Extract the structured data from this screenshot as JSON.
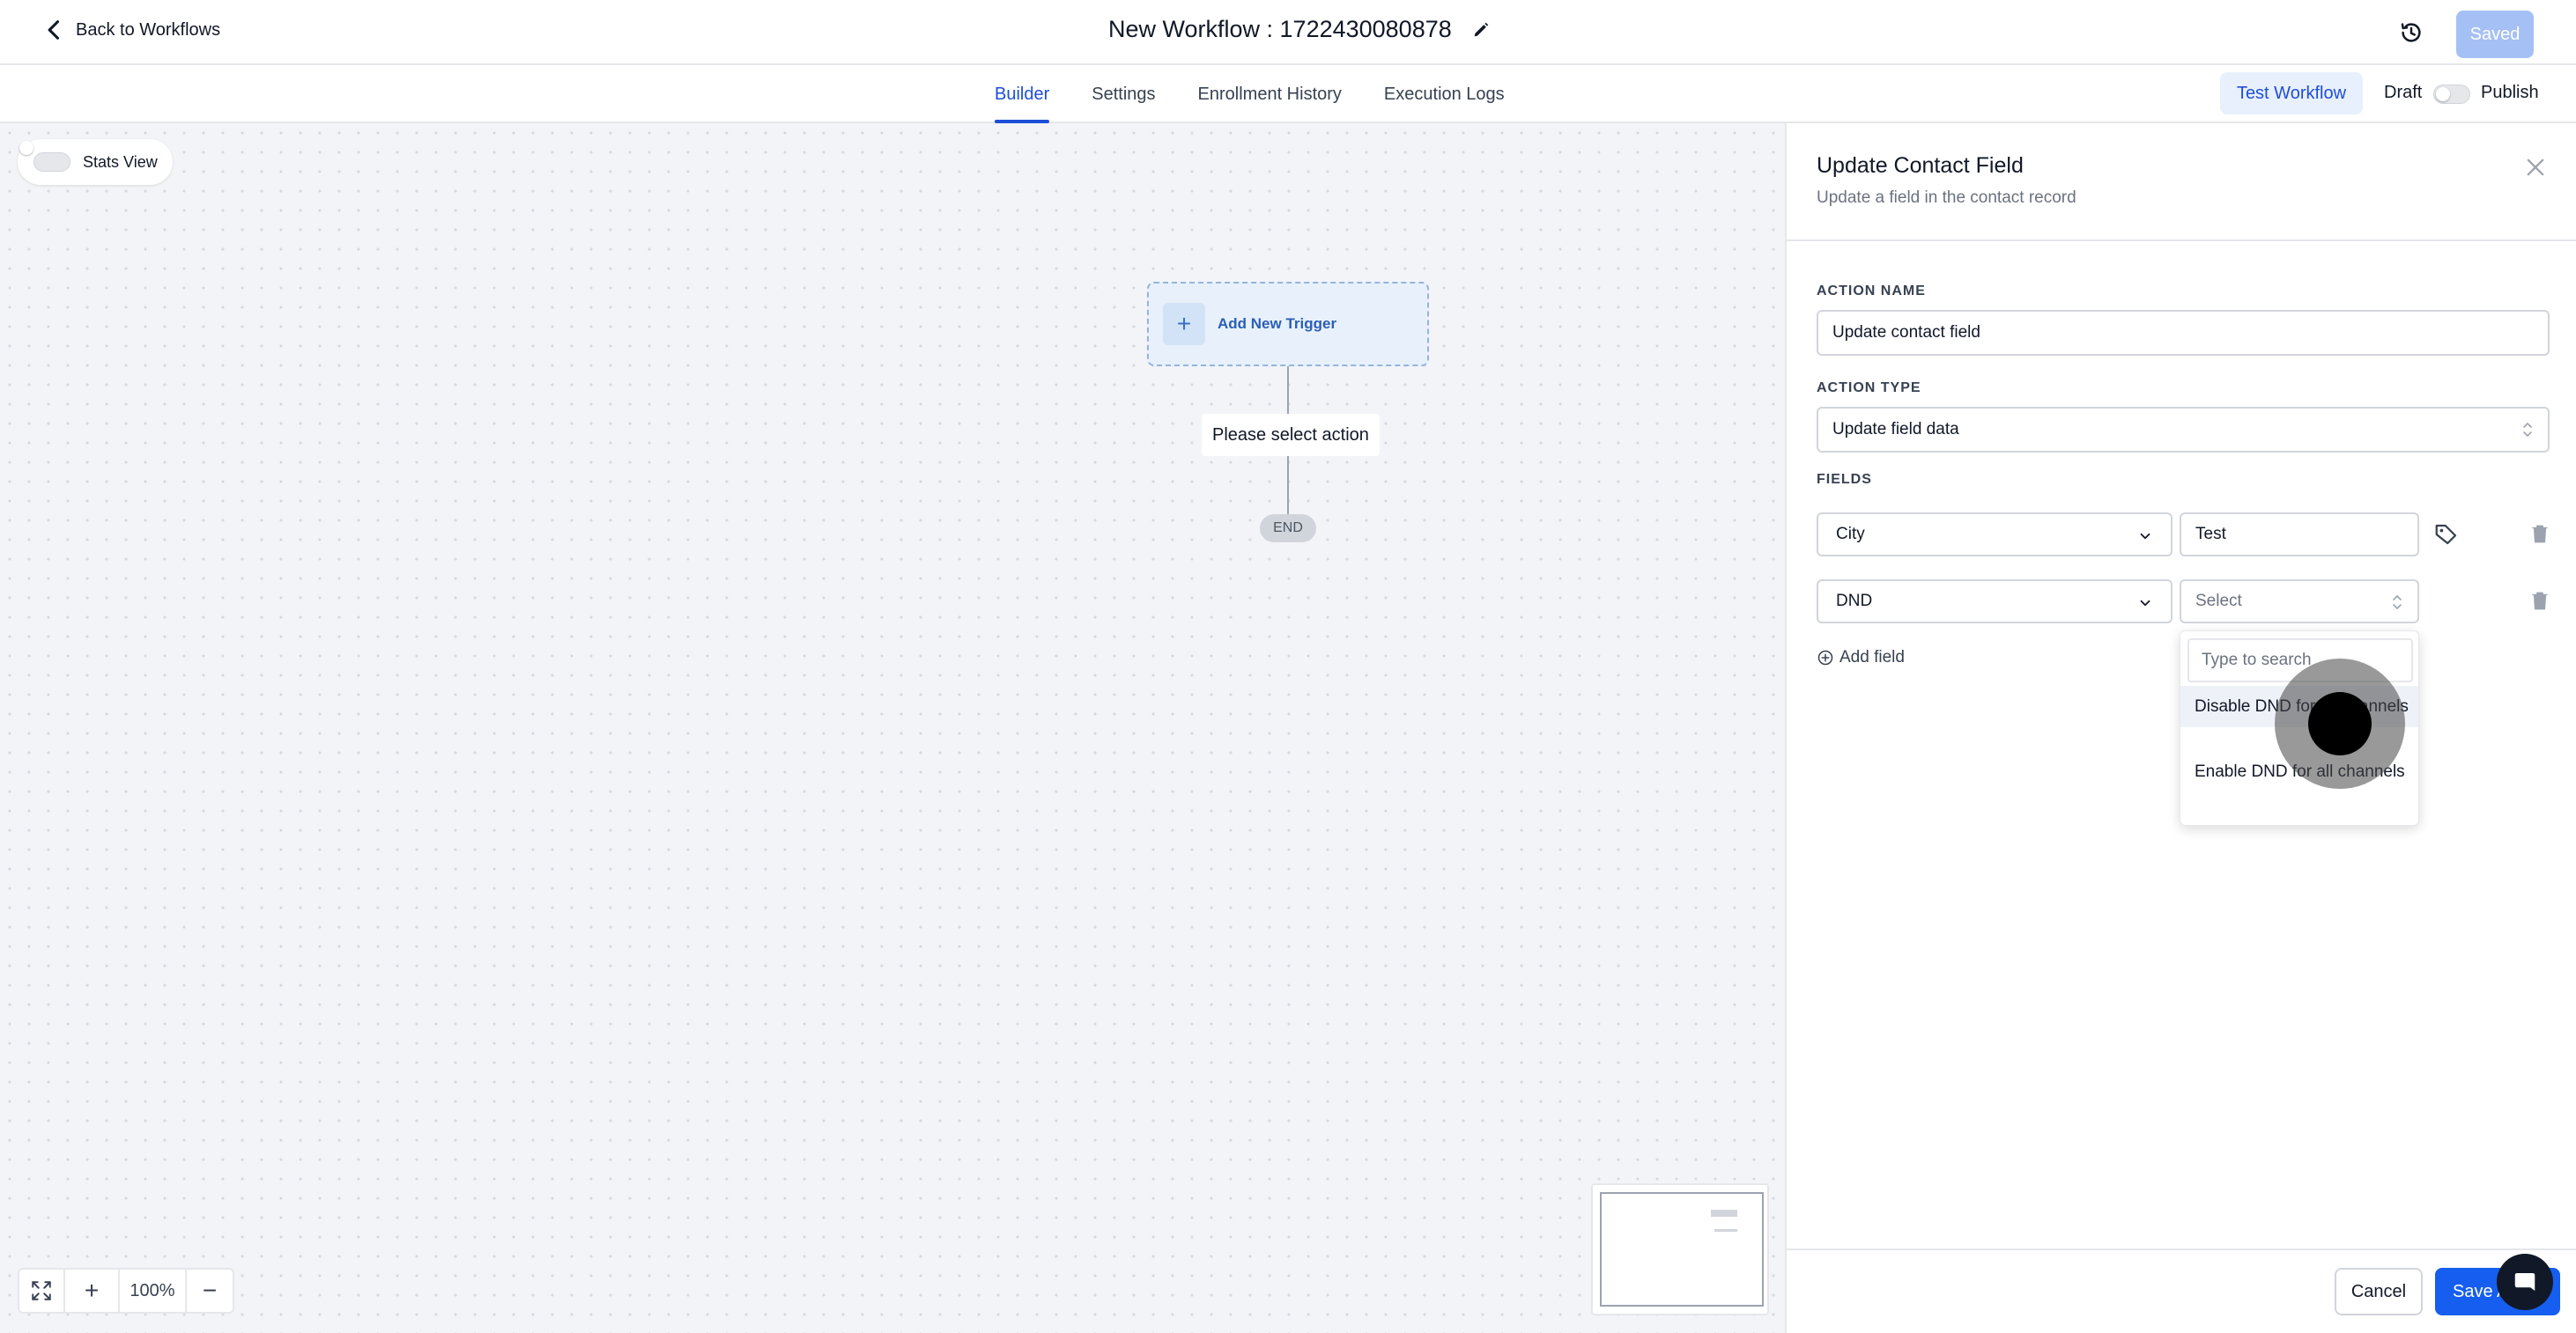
{
  "header": {
    "back_label": "Back to Workflows",
    "workflow_title": "New Workflow : 1722430080878",
    "saved_label": "Saved"
  },
  "tabs": [
    {
      "label": "Builder",
      "active": true
    },
    {
      "label": "Settings",
      "active": false
    },
    {
      "label": "Enrollment History",
      "active": false
    },
    {
      "label": "Execution Logs",
      "active": false
    }
  ],
  "actions": {
    "test_workflow_label": "Test Workflow",
    "draft_label": "Draft",
    "publish_label": "Publish"
  },
  "canvas": {
    "stats_view_label": "Stats View",
    "trigger_label": "Add New Trigger",
    "select_action_label": "Please select action",
    "end_label": "END",
    "zoom_level": "100%"
  },
  "panel": {
    "title": "Update Contact Field",
    "subtitle": "Update a field in the contact record",
    "action_name_label": "ACTION NAME",
    "action_name_value": "Update contact field",
    "action_type_label": "ACTION TYPE",
    "action_type_value": "Update field data",
    "fields_label": "FIELDS",
    "fields": [
      {
        "field": "City",
        "value": "Test",
        "placeholder": ""
      },
      {
        "field": "DND",
        "value": "",
        "placeholder": "Select"
      }
    ],
    "add_field_label": "Add field",
    "dropdown": {
      "search_placeholder": "Type to search",
      "options": [
        "Disable DND for all channels",
        "Enable DND for all channels"
      ]
    },
    "cancel_label": "Cancel",
    "save_label": "Save Action"
  },
  "colors": {
    "accent": "#155eef",
    "saved_disabled": "#a5c0f5",
    "trigger_bg": "#e8f1fb"
  },
  "icons": [
    "chevron-left-icon",
    "pencil-icon",
    "history-icon",
    "close-icon",
    "tag-icon",
    "trash-icon",
    "plus-circle-icon",
    "fit-view-icon",
    "chat-icon"
  ]
}
